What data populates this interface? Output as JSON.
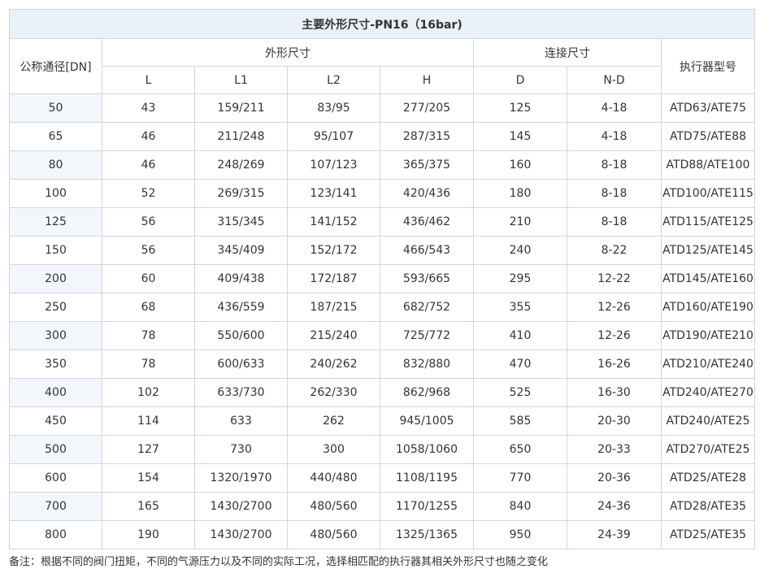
{
  "table": {
    "title": "主要外形尺寸-PN16（16bar)",
    "headers": {
      "dn": "公称通径[DN]",
      "outline_group": "外形尺寸",
      "connect_group": "连接尺寸",
      "actuator": "执行器型号",
      "L": "L",
      "L1": "L1",
      "L2": "L2",
      "H": "H",
      "D": "D",
      "ND": "N-D"
    },
    "rows": [
      [
        "50",
        "43",
        "159/211",
        "83/95",
        "277/205",
        "125",
        "4-18",
        "ATD63/ATE75"
      ],
      [
        "65",
        "46",
        "211/248",
        "95/107",
        "287/315",
        "145",
        "4-18",
        "ATD75/ATE88"
      ],
      [
        "80",
        "46",
        "248/269",
        "107/123",
        "365/375",
        "160",
        "8-18",
        "ATD88/ATE100"
      ],
      [
        "100",
        "52",
        "269/315",
        "123/141",
        "420/436",
        "180",
        "8-18",
        "ATD100/ATE115"
      ],
      [
        "125",
        "56",
        "315/345",
        "141/152",
        "436/462",
        "210",
        "8-18",
        "ATD115/ATE125"
      ],
      [
        "150",
        "56",
        "345/409",
        "152/172",
        "466/543",
        "240",
        "8-22",
        "ATD125/ATE145"
      ],
      [
        "200",
        "60",
        "409/438",
        "172/187",
        "593/665",
        "295",
        "12-22",
        "ATD145/ATE160"
      ],
      [
        "250",
        "68",
        "436/559",
        "187/215",
        "682/752",
        "355",
        "12-26",
        "ATD160/ATE190"
      ],
      [
        "300",
        "78",
        "550/600",
        "215/240",
        "725/772",
        "410",
        "12-26",
        "ATD190/ATE210"
      ],
      [
        "350",
        "78",
        "600/633",
        "240/262",
        "832/880",
        "470",
        "16-26",
        "ATD210/ATE240"
      ],
      [
        "400",
        "102",
        "633/730",
        "262/330",
        "862/968",
        "525",
        "16-30",
        "ATD240/ATE270"
      ],
      [
        "450",
        "114",
        "633",
        "262",
        "945/1005",
        "585",
        "20-30",
        "ATD240/ATE25"
      ],
      [
        "500",
        "127",
        "730",
        "300",
        "1058/1060",
        "650",
        "20-33",
        "ATD270/ATE25"
      ],
      [
        "600",
        "154",
        "1320/1970",
        "440/480",
        "1108/1195",
        "770",
        "20-36",
        "ATD25/ATE28"
      ],
      [
        "700",
        "165",
        "1430/2700",
        "480/560",
        "1170/1255",
        "840",
        "24-36",
        "ATD28/ATE35"
      ],
      [
        "800",
        "190",
        "1430/2700",
        "480/560",
        "1325/1365",
        "950",
        "24-39",
        "ATD25/ATE35"
      ]
    ]
  },
  "note": "备注：根据不同的阀门扭矩，不同的气源压力以及不同的实际工况，选择相匹配的执行器其相关外形尺寸也随之变化"
}
